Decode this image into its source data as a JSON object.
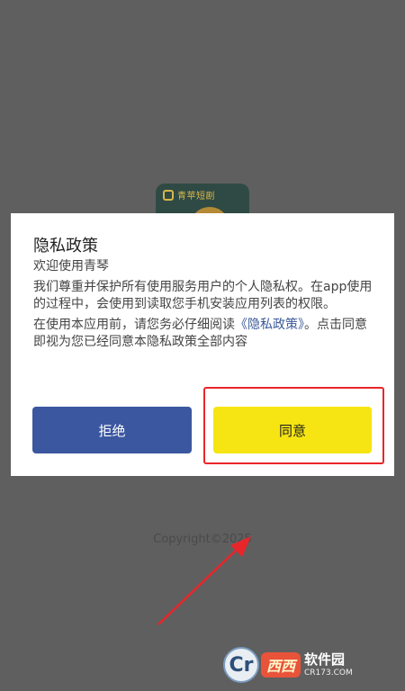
{
  "app_icon": {
    "name": "青苹短剧"
  },
  "dialog": {
    "title": "隐私政策",
    "line1": "欢迎使用青琴",
    "paragraph1": "我们尊重并保护所有使用服务用户的个人隐私权。在app使用的过程中，会使用到读取您手机安装应用列表的权限。",
    "paragraph2_prefix": "在使用本应用前，请您务必仔细阅读",
    "paragraph2_link": "《隐私政策》",
    "paragraph2_suffix": "。点击同意即视为您已经同意本隐私政策全部内容",
    "reject_label": "拒绝",
    "agree_label": "同意"
  },
  "footer": {
    "copyright": "Copyright©2025"
  },
  "watermark": {
    "logo_letter": "Cr",
    "brand": "西西",
    "name": "软件园",
    "domain": "CR173.COM"
  },
  "colors": {
    "overlay": "#5f5f5f",
    "reject_button": "#3b57a0",
    "agree_button": "#f6e512",
    "highlight": "#e8262a",
    "link": "#3a5a9a"
  }
}
